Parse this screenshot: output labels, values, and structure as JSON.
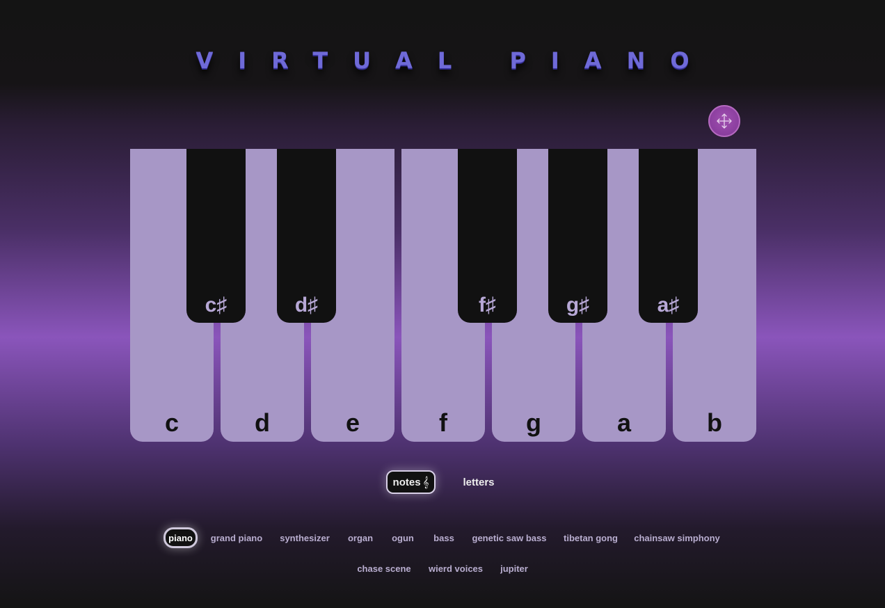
{
  "title": "VIRTUAL PIANO",
  "move_icon": "move-arrows-icon",
  "keys": {
    "white": [
      "c",
      "d",
      "e",
      "f",
      "g",
      "a",
      "b"
    ],
    "black": [
      "c♯",
      "d♯",
      "f♯",
      "g♯",
      "a♯"
    ]
  },
  "label_modes": {
    "notes": "notes",
    "notes_icon": "𝄞",
    "letters": "letters",
    "selected": "notes"
  },
  "sounds": {
    "row1": [
      "piano",
      "grand piano",
      "synthesizer",
      "organ",
      "ogun",
      "bass",
      "genetic saw bass",
      "tibetan gong",
      "chainsaw simphony"
    ],
    "row2": [
      "chase scene",
      "wierd voices",
      "jupiter"
    ],
    "selected": "piano"
  },
  "colors": {
    "title": "#6f6ad8",
    "white_key": "#a797c6",
    "black_key": "#111111",
    "accent": "#8a55bb"
  }
}
